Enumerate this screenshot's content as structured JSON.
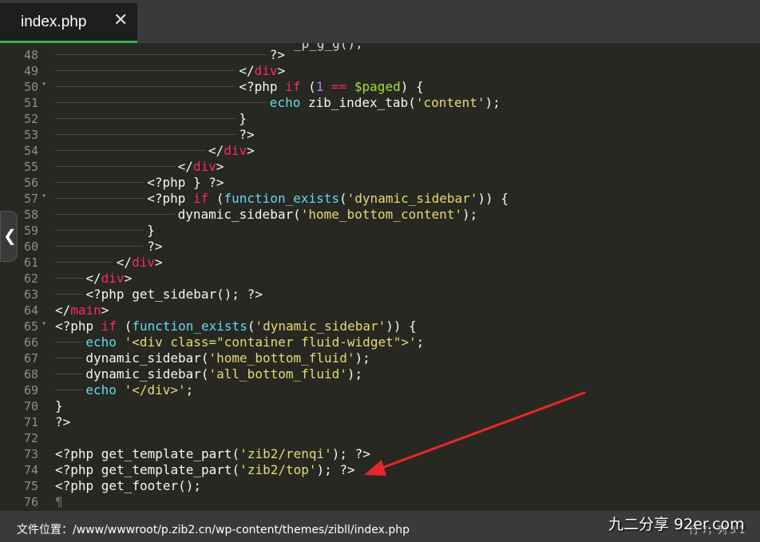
{
  "tab": {
    "title": "index.php",
    "close_icon": "close-icon"
  },
  "editor": {
    "partial_top_line": "_p_g_g();",
    "lines": [
      {
        "num": "48",
        "fold": false,
        "indent": 7,
        "tokens": [
          [
            "p",
            "?>"
          ]
        ]
      },
      {
        "num": "49",
        "fold": false,
        "indent": 6,
        "tokens": [
          [
            "p",
            "</"
          ],
          [
            "t",
            "div"
          ],
          [
            "p",
            ">"
          ]
        ]
      },
      {
        "num": "50",
        "fold": true,
        "indent": 6,
        "tokens": [
          [
            "p",
            "<?php "
          ],
          [
            "k",
            "if"
          ],
          [
            "p",
            " ("
          ],
          [
            "n",
            "1"
          ],
          [
            "p",
            " "
          ],
          [
            "k",
            "=="
          ],
          [
            "p",
            " "
          ],
          [
            "v",
            "$paged"
          ],
          [
            "p",
            ") {"
          ]
        ]
      },
      {
        "num": "51",
        "fold": false,
        "indent": 7,
        "tokens": [
          [
            "f",
            "echo"
          ],
          [
            "p",
            " zib_index_tab("
          ],
          [
            "s",
            "'content'"
          ],
          [
            "p",
            ");"
          ]
        ]
      },
      {
        "num": "52",
        "fold": false,
        "indent": 6,
        "tokens": [
          [
            "p",
            "}"
          ]
        ]
      },
      {
        "num": "53",
        "fold": false,
        "indent": 6,
        "tokens": [
          [
            "p",
            "?>"
          ]
        ]
      },
      {
        "num": "54",
        "fold": false,
        "indent": 5,
        "tokens": [
          [
            "p",
            "</"
          ],
          [
            "t",
            "div"
          ],
          [
            "p",
            ">"
          ]
        ]
      },
      {
        "num": "55",
        "fold": false,
        "indent": 4,
        "tokens": [
          [
            "p",
            "</"
          ],
          [
            "t",
            "div"
          ],
          [
            "p",
            ">"
          ]
        ]
      },
      {
        "num": "56",
        "fold": false,
        "indent": 3,
        "tokens": [
          [
            "p",
            "<?php } ?>"
          ]
        ]
      },
      {
        "num": "57",
        "fold": true,
        "indent": 3,
        "tokens": [
          [
            "p",
            "<?php "
          ],
          [
            "k",
            "if"
          ],
          [
            "p",
            " ("
          ],
          [
            "f",
            "function_exists"
          ],
          [
            "p",
            "("
          ],
          [
            "s",
            "'dynamic_sidebar'"
          ],
          [
            "p",
            ")) {"
          ]
        ]
      },
      {
        "num": "58",
        "fold": false,
        "indent": 4,
        "tokens": [
          [
            "p",
            "dynamic_sidebar("
          ],
          [
            "s",
            "'home_bottom_content'"
          ],
          [
            "p",
            ");"
          ]
        ]
      },
      {
        "num": "59",
        "fold": false,
        "indent": 3,
        "tokens": [
          [
            "p",
            "}"
          ]
        ]
      },
      {
        "num": "60",
        "fold": false,
        "indent": 3,
        "tokens": [
          [
            "p",
            "?>"
          ]
        ]
      },
      {
        "num": "61",
        "fold": false,
        "indent": 2,
        "tokens": [
          [
            "p",
            "</"
          ],
          [
            "t",
            "div"
          ],
          [
            "p",
            ">"
          ]
        ]
      },
      {
        "num": "62",
        "fold": false,
        "indent": 1,
        "tokens": [
          [
            "p",
            "</"
          ],
          [
            "t",
            "div"
          ],
          [
            "p",
            ">"
          ]
        ]
      },
      {
        "num": "63",
        "fold": false,
        "indent": 1,
        "tokens": [
          [
            "p",
            "<?php get_sidebar(); ?>"
          ]
        ]
      },
      {
        "num": "64",
        "fold": false,
        "indent": 0,
        "tokens": [
          [
            "p",
            "</"
          ],
          [
            "t",
            "main"
          ],
          [
            "p",
            ">"
          ]
        ]
      },
      {
        "num": "65",
        "fold": true,
        "indent": 0,
        "tokens": [
          [
            "p",
            "<?php "
          ],
          [
            "k",
            "if"
          ],
          [
            "p",
            " ("
          ],
          [
            "f",
            "function_exists"
          ],
          [
            "p",
            "("
          ],
          [
            "s",
            "'dynamic_sidebar'"
          ],
          [
            "p",
            ")) {"
          ]
        ]
      },
      {
        "num": "66",
        "fold": false,
        "indent": 1,
        "tokens": [
          [
            "f",
            "echo"
          ],
          [
            "p",
            " "
          ],
          [
            "s",
            "'<div class=\"container fluid-widget\">'"
          ],
          [
            "p",
            ";"
          ]
        ]
      },
      {
        "num": "67",
        "fold": false,
        "indent": 1,
        "tokens": [
          [
            "p",
            "dynamic_sidebar("
          ],
          [
            "s",
            "'home_bottom_fluid'"
          ],
          [
            "p",
            ");"
          ]
        ]
      },
      {
        "num": "68",
        "fold": false,
        "indent": 1,
        "tokens": [
          [
            "p",
            "dynamic_sidebar("
          ],
          [
            "s",
            "'all_bottom_fluid'"
          ],
          [
            "p",
            ");"
          ]
        ]
      },
      {
        "num": "69",
        "fold": false,
        "indent": 1,
        "tokens": [
          [
            "f",
            "echo"
          ],
          [
            "p",
            " "
          ],
          [
            "s",
            "'</div>'"
          ],
          [
            "p",
            ";"
          ]
        ]
      },
      {
        "num": "70",
        "fold": false,
        "indent": 0,
        "tokens": [
          [
            "p",
            "}"
          ]
        ]
      },
      {
        "num": "71",
        "fold": false,
        "indent": 0,
        "tokens": [
          [
            "p",
            "?>"
          ]
        ]
      },
      {
        "num": "72",
        "fold": false,
        "indent": 0,
        "tokens": []
      },
      {
        "num": "73",
        "fold": false,
        "indent": 0,
        "tokens": [
          [
            "p",
            "<?php get_template_part("
          ],
          [
            "s",
            "'zib2/renqi'"
          ],
          [
            "p",
            "); ?>"
          ]
        ]
      },
      {
        "num": "74",
        "fold": false,
        "indent": 0,
        "tokens": [
          [
            "p",
            "<?php get_template_part("
          ],
          [
            "s",
            "'zib2/top'"
          ],
          [
            "p",
            "); ?>"
          ]
        ]
      },
      {
        "num": "75",
        "fold": false,
        "indent": 0,
        "tokens": [
          [
            "p",
            "<?php get_footer();"
          ]
        ]
      },
      {
        "num": "76",
        "fold": false,
        "indent": 0,
        "tokens": [
          [
            "eol",
            "¶"
          ]
        ]
      }
    ]
  },
  "sidebar_toggle": {
    "icon": "chevron-left-icon",
    "glyph": "❮"
  },
  "status": {
    "path": "文件位置：/www/wwwroot/p.zib2.cn/wp-content/themes/zibll/index.php",
    "position": "行 7，列 3 1"
  },
  "watermark": "九二分享 92er.com",
  "annotation_arrow": {
    "color": "#e8262b"
  }
}
